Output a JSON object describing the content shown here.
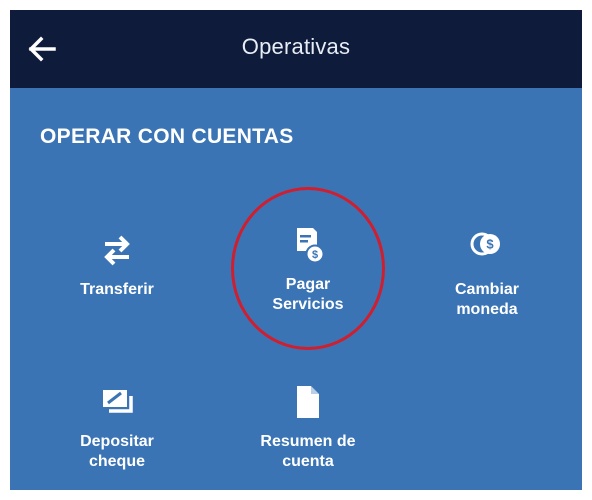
{
  "header": {
    "title": "Operativas",
    "back_icon": "arrow-left-icon"
  },
  "section": {
    "title": "OPERAR CON CUENTAS"
  },
  "operations": {
    "transferir": {
      "label": "Transferir",
      "icon": "transfer-arrows-icon"
    },
    "pagar": {
      "line1": "Pagar",
      "line2": "Servicios",
      "icon": "bill-dollar-icon"
    },
    "cambiar": {
      "line1": "Cambiar",
      "line2": "moneda",
      "icon": "currency-exchange-icon"
    },
    "depositar": {
      "line1": "Depositar",
      "line2": "cheque",
      "icon": "check-deposit-icon"
    },
    "resumen": {
      "line1": "Resumen de",
      "line2": "cuenta",
      "icon": "document-icon"
    }
  },
  "colors": {
    "header_bg": "#0f1b3b",
    "panel_bg": "#3a74b5",
    "highlight_ring": "#d01e2e"
  }
}
